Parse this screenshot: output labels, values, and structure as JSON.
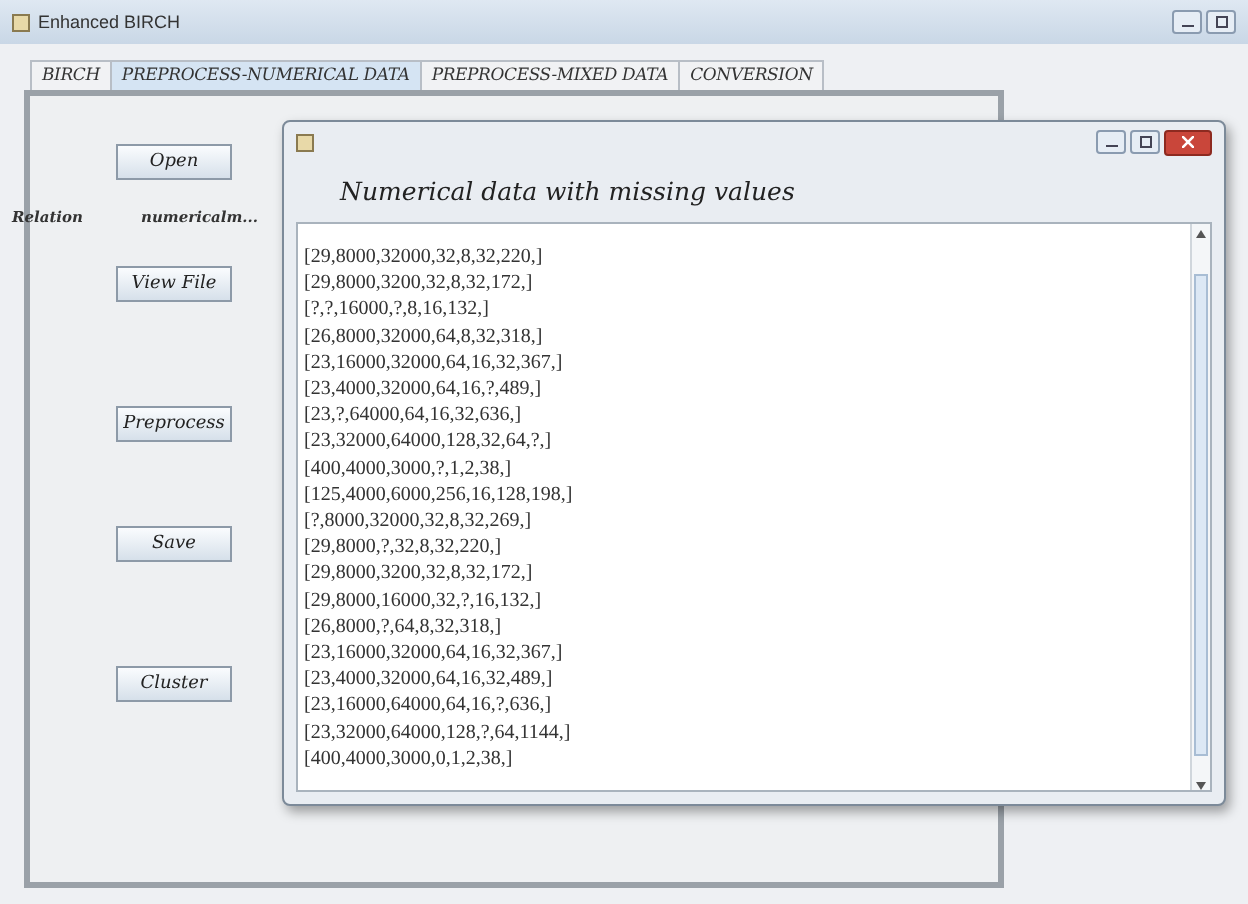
{
  "window": {
    "title": "Enhanced BIRCH"
  },
  "tabs": [
    {
      "label": "BIRCH",
      "selected": false
    },
    {
      "label": "PREPROCESS-NUMERICAL DATA",
      "selected": true
    },
    {
      "label": "PREPROCESS-MIXED DATA",
      "selected": false
    },
    {
      "label": "CONVERSION",
      "selected": false
    }
  ],
  "panel": {
    "buttons": [
      "Open",
      "View File",
      "Preprocess",
      "Save",
      "Cluster"
    ],
    "relation_label": "Relation",
    "relation_value": "numericalm..."
  },
  "dialog": {
    "heading": "Numerical data with missing values",
    "lines": [
      "[29,8000,32000,32,8,32,220,]",
      "[29,8000,3200,32,8,32,172,]",
      "[?,?,16000,?,8,16,132,]",
      "[26,8000,32000,64,8,32,318,]",
      "[23,16000,32000,64,16,32,367,]",
      "[23,4000,32000,64,16,?,489,]",
      "[23,?,64000,64,16,32,636,]",
      "[23,32000,64000,128,32,64,?,]",
      "[400,4000,3000,?,1,2,38,]",
      "[125,4000,6000,256,16,128,198,]",
      "[?,8000,32000,32,8,32,269,]",
      "[29,8000,?,32,8,32,220,]",
      "[29,8000,3200,32,8,32,172,]",
      "[29,8000,16000,32,?,16,132,]",
      "[26,8000,?,64,8,32,318,]",
      "[23,16000,32000,64,16,32,367,]",
      "[23,4000,32000,64,16,32,489,]",
      "[23,16000,64000,64,16,?,636,]",
      "[23,32000,64000,128,?,64,1144,]",
      "[400,4000,3000,0,1,2,38,]"
    ]
  }
}
